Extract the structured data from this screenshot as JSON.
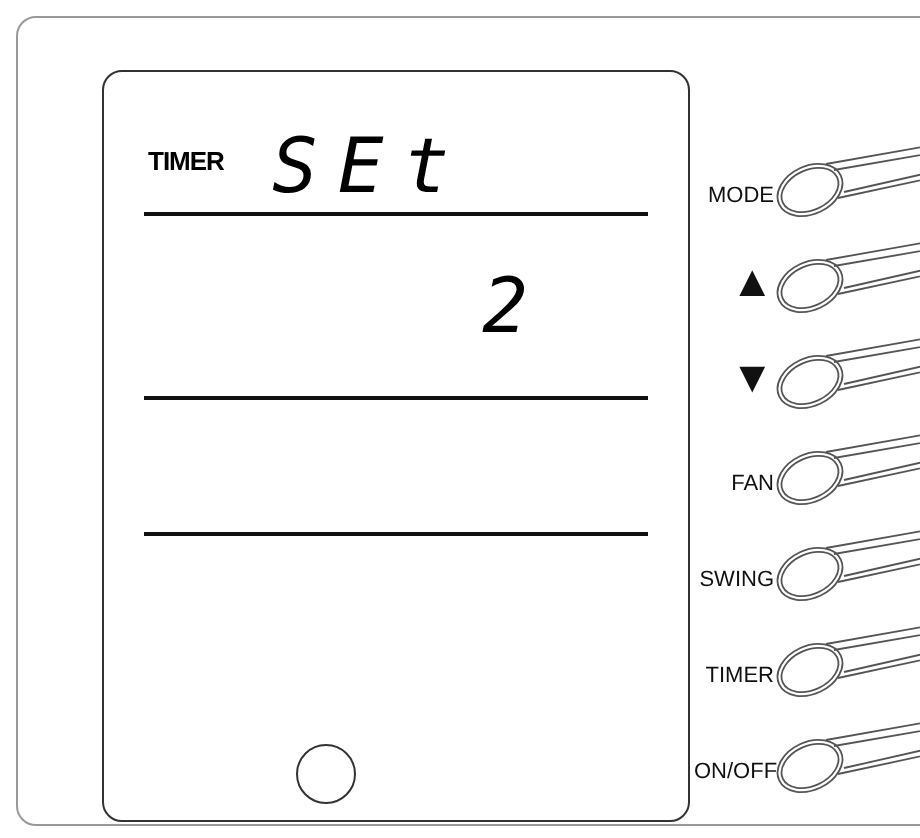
{
  "display": {
    "mode_label": "TIMER",
    "segment_text": "SEt",
    "value": "2"
  },
  "buttons": [
    {
      "kind": "text",
      "label": "MODE"
    },
    {
      "kind": "symbol",
      "label": "▲"
    },
    {
      "kind": "symbol",
      "label": "▼"
    },
    {
      "kind": "text",
      "label": "FAN"
    },
    {
      "kind": "text",
      "label": "SWING"
    },
    {
      "kind": "text",
      "label": "TIMER"
    },
    {
      "kind": "text",
      "label": "ON/OFF"
    }
  ]
}
